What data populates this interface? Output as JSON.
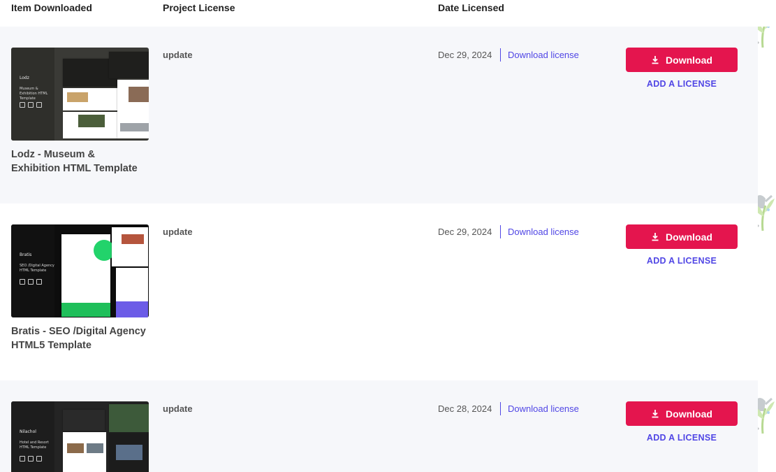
{
  "table": {
    "headers": {
      "item": "Item Downloaded",
      "project": "Project License",
      "date": "Date Licensed"
    },
    "rows": [
      {
        "title_line1": "Lodz - Museum &",
        "title_line2": "Exhibition HTML Template",
        "thumb_brand": "Lodz",
        "thumb_tagline": "Museum & Exhibition HTML Template",
        "project_license": "update",
        "date": "Dec 29, 2024",
        "download_license_label": "Download license",
        "download_label": "Download",
        "add_license_label": "ADD A LICENSE"
      },
      {
        "title_line1": "Bratis - SEO /Digital Agency",
        "title_line2": "HTML5 Template",
        "thumb_brand": "Bratis",
        "thumb_tagline": "SEO /Digital Agency HTML Template",
        "project_license": "update",
        "date": "Dec 29, 2024",
        "download_license_label": "Download license",
        "download_label": "Download",
        "add_license_label": "ADD A LICENSE"
      },
      {
        "title_line1": "",
        "title_line2": "",
        "thumb_brand": "Nilachol",
        "thumb_tagline": "Hotel and Resort HTML Template",
        "project_license": "update",
        "date": "Dec 28, 2024",
        "download_license_label": "Download license",
        "download_label": "Download",
        "add_license_label": "ADD A LICENSE"
      }
    ]
  },
  "colors": {
    "accent": "#e4154e",
    "link": "#5046e5",
    "row_shade": "#f6f7fa"
  },
  "icons": {
    "download": "download-icon",
    "watermark": "watering-can-plant-icon"
  }
}
